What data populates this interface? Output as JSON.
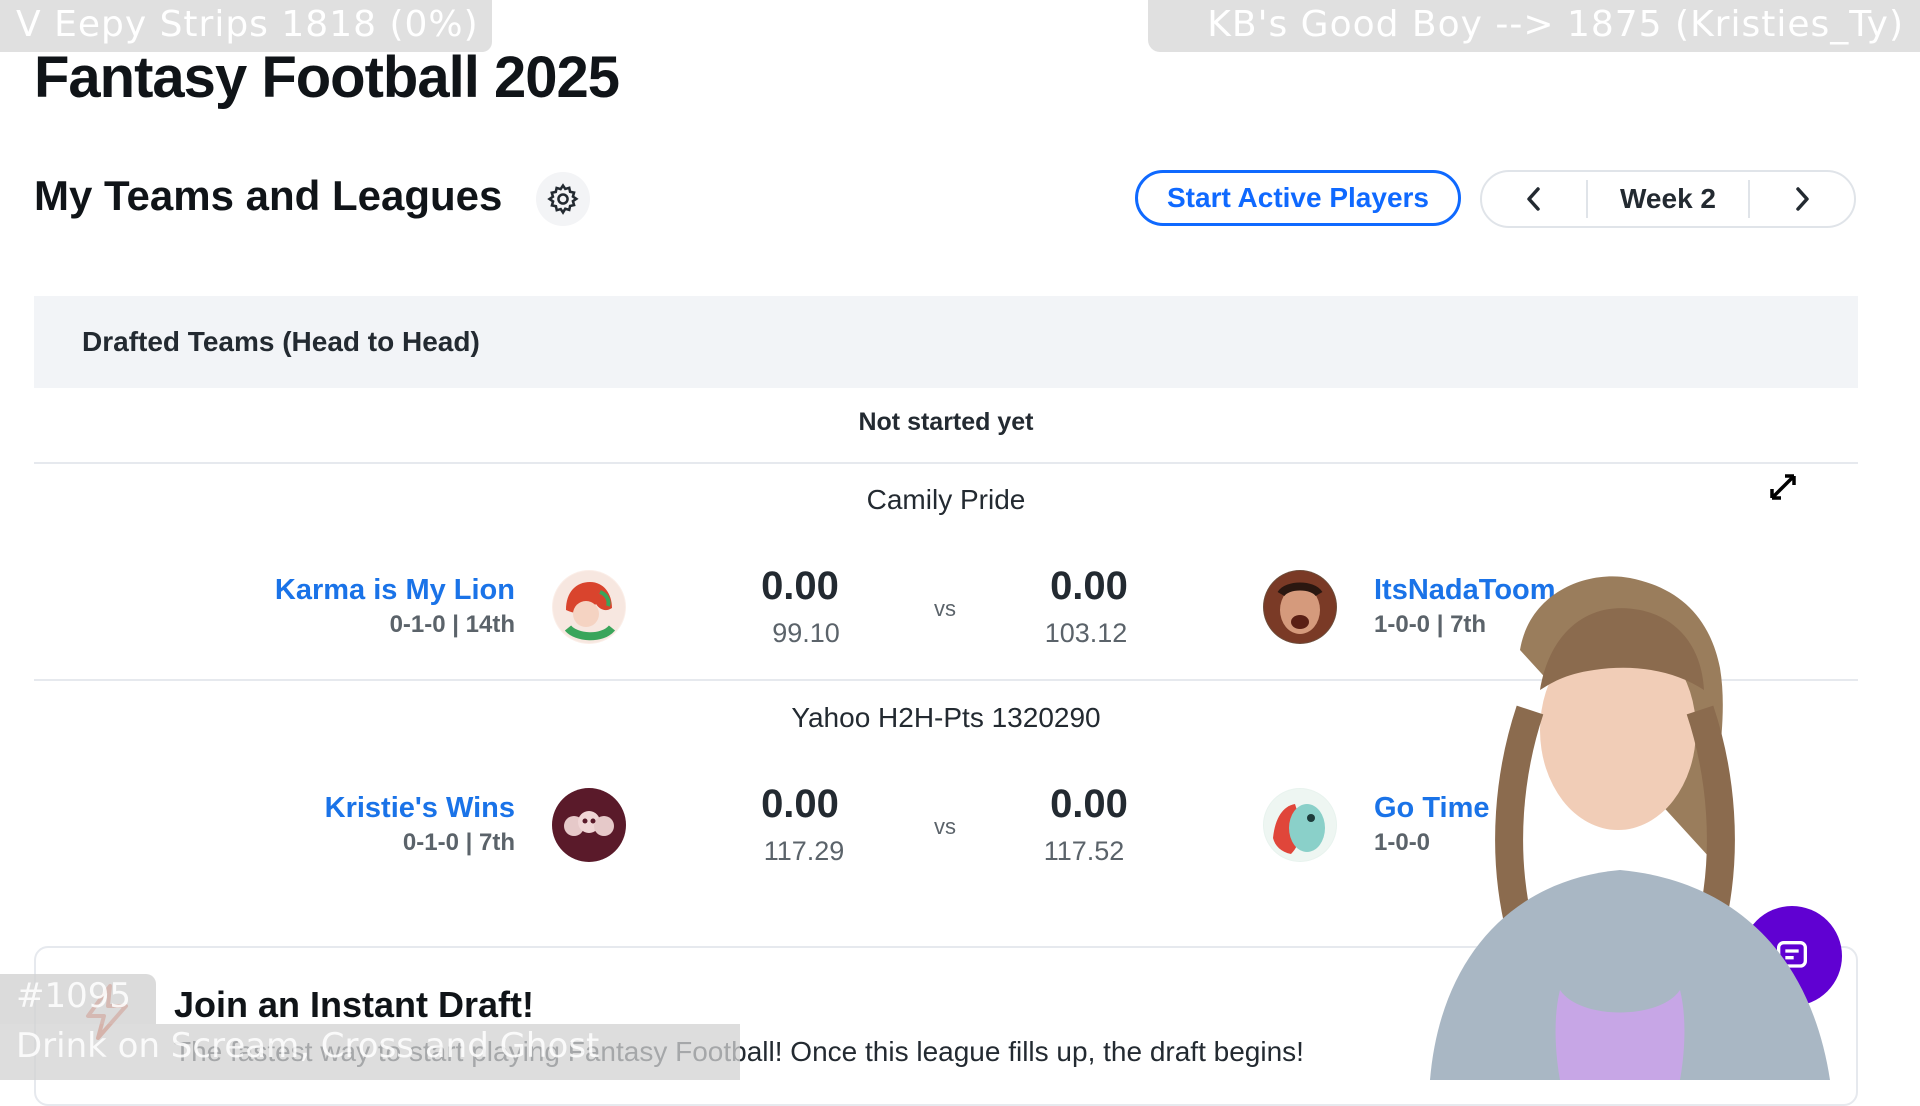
{
  "overlays": {
    "top_left": "V Eepy Strips 1818 (0%)",
    "top_right": "KB's Good Boy --> 1875 (Kristies_Ty)",
    "bottom_number": "#1095",
    "bottom_text": "Drink on Scream, Cross and Ghost"
  },
  "page": {
    "title": "Fantasy Football 2025"
  },
  "header": {
    "section_title": "My Teams and Leagues",
    "start_button": "Start Active Players",
    "week_label": "Week 2"
  },
  "panel": {
    "title": "Drafted Teams (Head to Head)",
    "status": "Not started yet"
  },
  "leagues": [
    {
      "name": "Camily Pride",
      "left_team": {
        "name": "Karma is My Lion",
        "record": "0-1-0 | 14th",
        "score": "0.00",
        "projected": "99.10"
      },
      "vs": "vs",
      "right_team": {
        "name": "ItsNadaToom",
        "record": "1-0-0 | 7th",
        "score": "0.00",
        "projected": "103.12"
      }
    },
    {
      "name": "Yahoo H2H-Pts 1320290",
      "left_team": {
        "name": "Kristie's Wins",
        "record": "0-1-0 | 7th",
        "score": "0.00",
        "projected": "117.29"
      },
      "vs": "vs",
      "right_team": {
        "name": "Go Time F",
        "record": "1-0-0",
        "score": "0.00",
        "projected": "117.52"
      }
    }
  ],
  "instant_draft": {
    "title": "Join an Instant Draft!",
    "description": "The fastest way to start playing Fantasy Football! Once this league fills up, the draft begins!"
  },
  "colors": {
    "accent": "#0f69ff",
    "link": "#1a73e8",
    "fab": "#6001d2"
  }
}
